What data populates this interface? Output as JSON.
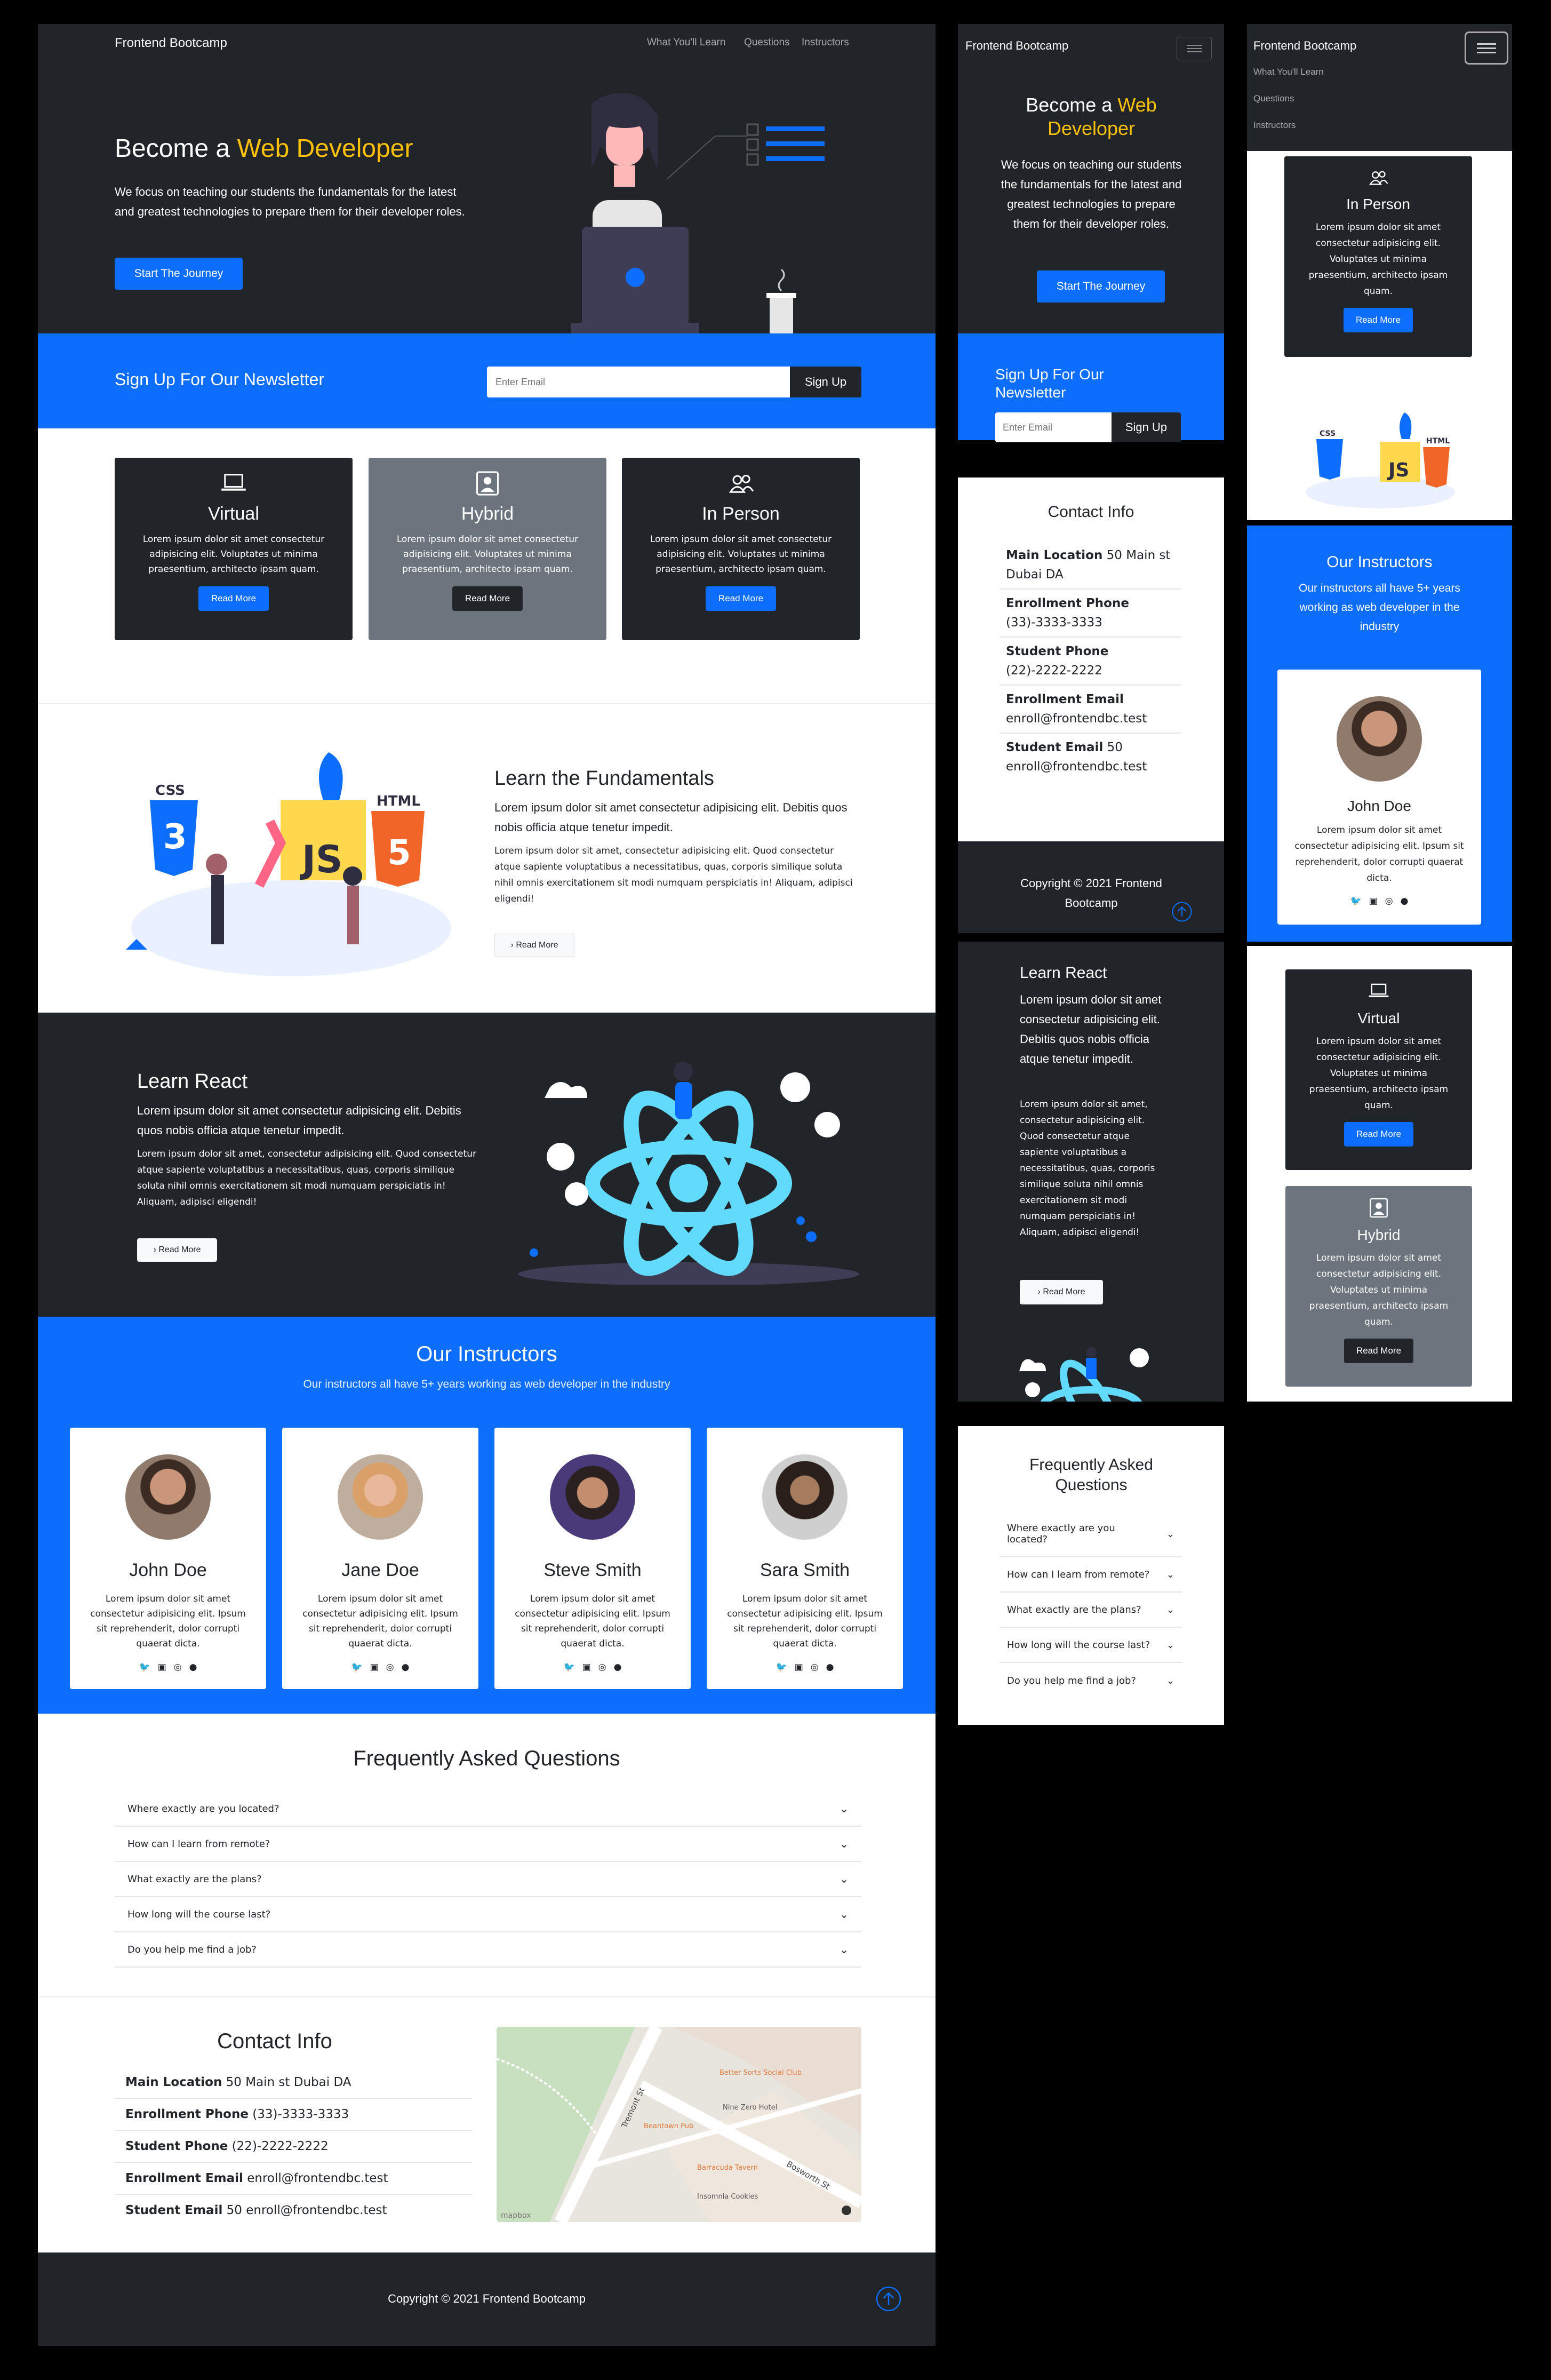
{
  "colors": {
    "dark": "#212529",
    "primary": "#0d6efd",
    "grey": "#6c757d",
    "accent": "#ffc107",
    "light": "#f8f9fa"
  },
  "nav": {
    "brand": "Frontend Bootcamp",
    "links": [
      "What You'll Learn",
      "Questions",
      "Instructors"
    ]
  },
  "hero": {
    "title_prefix": "Become a",
    "title_accent": "Web Developer",
    "text": "We focus on teaching our students the fundamentals for the latest and greatest technologies to prepare them for their developer roles.",
    "button": "Start The Journey"
  },
  "newsletter": {
    "title": "Sign Up For Our Newsletter",
    "placeholder": "Enter Email",
    "button": "Sign Up"
  },
  "boxes": [
    {
      "icon": "laptop-icon",
      "title": "Virtual",
      "text": "Lorem ipsum dolor sit amet consectetur adipisicing elit. Voluptates ut minima praesentium, architecto ipsam quam.",
      "button": "Read More"
    },
    {
      "icon": "person-badge-icon",
      "title": "Hybrid",
      "text": "Lorem ipsum dolor sit amet consectetur adipisicing elit. Voluptates ut minima praesentium, architecto ipsam quam.",
      "button": "Read More"
    },
    {
      "icon": "people-icon",
      "title": "In Person",
      "text": "Lorem ipsum dolor sit amet consectetur adipisicing elit. Voluptates ut minima praesentium, architecto ipsam quam.",
      "button": "Read More"
    }
  ],
  "learn_fundamentals": {
    "title": "Learn the Fundamentals",
    "lead": "Lorem ipsum dolor sit amet consectetur adipisicing elit. Debitis quos nobis officia atque tenetur impedit.",
    "text": "Lorem ipsum dolor sit amet, consectetur adipisicing elit. Quod consectetur atque sapiente voluptatibus a necessitatibus, quas, corporis similique soluta nihil omnis exercitationem sit modi numquam perspiciatis in! Aliquam, adipisci eligendi!",
    "button": "Read More",
    "logo_css": "CSS",
    "logo_js": "JS",
    "logo_html": "HTML"
  },
  "learn_react": {
    "title": "Learn React",
    "lead": "Lorem ipsum dolor sit amet consectetur adipisicing elit. Debitis quos nobis officia atque tenetur impedit.",
    "text": "Lorem ipsum dolor sit amet, consectetur adipisicing elit. Quod consectetur atque sapiente voluptatibus a necessitatibus, quas, corporis similique soluta nihil omnis exercitationem sit modi numquam perspiciatis in! Aliquam, adipisci eligendi!",
    "button": "Read More"
  },
  "instructors": {
    "title": "Our Instructors",
    "subtitle": "Our instructors all have 5+ years working as web developer in the industry",
    "people": [
      {
        "name": "John Doe",
        "text": "Lorem ipsum dolor sit amet consectetur adipisicing elit. Ipsum sit reprehenderit, dolor corrupti quaerat dicta."
      },
      {
        "name": "Jane Doe",
        "text": "Lorem ipsum dolor sit amet consectetur adipisicing elit. Ipsum sit reprehenderit, dolor corrupti quaerat dicta."
      },
      {
        "name": "Steve Smith",
        "text": "Lorem ipsum dolor sit amet consectetur adipisicing elit. Ipsum sit reprehenderit, dolor corrupti quaerat dicta."
      },
      {
        "name": "Sara Smith",
        "text": "Lorem ipsum dolor sit amet consectetur adipisicing elit. Ipsum sit reprehenderit, dolor corrupti quaerat dicta."
      }
    ],
    "social_icons": [
      "twitter-icon",
      "linkedin-icon",
      "instagram-icon",
      "facebook-icon"
    ]
  },
  "faq": {
    "title": "Frequently Asked Questions",
    "questions": [
      "Where exactly are you located?",
      "How can I learn from remote?",
      "What exactly are the plans?",
      "How long will the course last?",
      "Do you help me find a job?"
    ]
  },
  "contact": {
    "title": "Contact Info",
    "items": [
      {
        "label": "Main Location",
        "value": "50 Main st Dubai DA"
      },
      {
        "label": "Enrollment Phone",
        "value": "(33)-3333-3333"
      },
      {
        "label": "Student Phone",
        "value": "(22)-2222-2222"
      },
      {
        "label": "Enrollment Email",
        "value": "enroll@frontendbc.test"
      },
      {
        "label": "Student Email",
        "value": "50 enroll@frontendbc.test"
      }
    ]
  },
  "map": {
    "labels": [
      "Better Sorts Social Club",
      "Nine Zero Hotel",
      "Beantown Pub",
      "Barracuda Tavern",
      "Insomnia Cookies",
      "Tremont St",
      "Bosworth St"
    ],
    "attribution": "mapbox"
  },
  "footer": {
    "copyright": "Copyright © 2021 Frontend Bootcamp"
  }
}
